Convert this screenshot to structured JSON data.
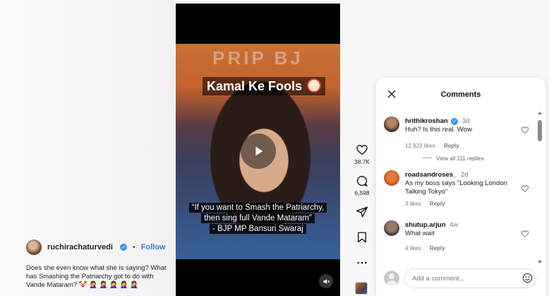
{
  "post": {
    "author": "ruchirachaturvedi",
    "follow_label": "Follow",
    "dot": "•",
    "caption": "Does she even know what she is saying? What has Smashing the Patriarchy got to do with Vande Mataram? 🤡 🤦‍♀️ 🤦‍♀️ 🤦‍♀️ 🤦‍♀️ 🤦‍♀️"
  },
  "video": {
    "banner": "PRIP BJ",
    "title": "Kamal Ke Fools",
    "quote_line1": "“If you want to Smash the Patriarchy,",
    "quote_line2": "then sing full Vande Mataram”",
    "quote_line3": "- BJP MP Bansuri Swaraj"
  },
  "actions": {
    "likes": "38.7K",
    "comments": "6,598",
    "icons": [
      "heart-icon",
      "comment-icon",
      "share-icon",
      "save-icon",
      "more-icon"
    ]
  },
  "comments_panel": {
    "title": "Comments",
    "comments": [
      {
        "user": "hrithikroshan",
        "verified": true,
        "time": "3d",
        "text": "Huh? Is this real. Wow",
        "likes": "12,923 likes",
        "reply": "Reply",
        "view_replies": "View all 111 replies"
      },
      {
        "user": "roadsandroses_",
        "time": "2d",
        "text": "As my boss says \"Looking London Talking Tokyo\"",
        "likes": "3 likes",
        "reply": "Reply"
      },
      {
        "user": "shutup.arjun",
        "time": "4w",
        "text": "What wait",
        "likes": "4 likes",
        "reply": "Reply"
      }
    ],
    "composer_placeholder": "Add a comment..."
  },
  "colors": {
    "accent": "#3a7cd6",
    "verified": "#3897f0",
    "panel_bg": "#ffffff"
  }
}
